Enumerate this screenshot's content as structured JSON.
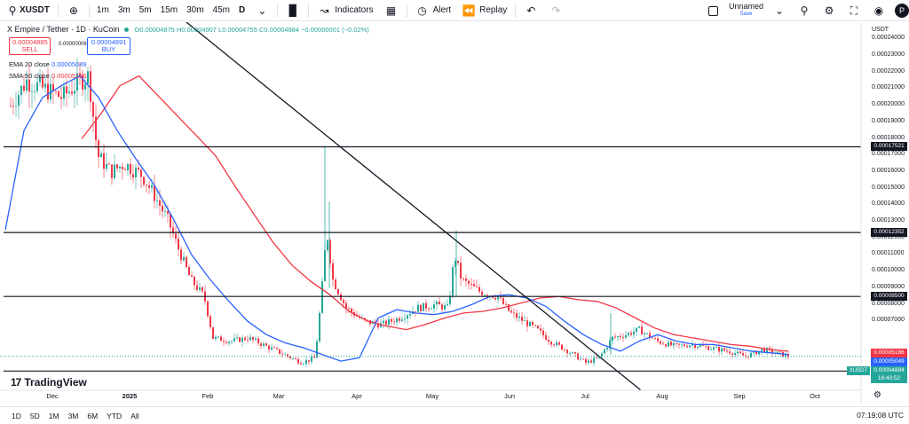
{
  "toolbar": {
    "symbol": "XUSDT",
    "timeframes": [
      "1m",
      "3m",
      "5m",
      "15m",
      "30m",
      "45m",
      "D"
    ],
    "active_timeframe": "D",
    "indicators_label": "Indicators",
    "alert_label": "Alert",
    "replay_label": "Replay",
    "layout_name": "Unnamed",
    "layout_save": "Save",
    "avatar_letter": "P"
  },
  "legend": {
    "title": "X Empire / Tether · 1D · KuCoin",
    "ohlc": "O0.00004875 H0.00004907 L0.00004755 C0.00004884 −0.00000001 (−0.02%)",
    "sell_price": "0.00004885",
    "sell_label": "SELL",
    "spread": "0.00000006",
    "buy_price": "0.00004891",
    "buy_label": "BUY",
    "ema_label": "EMA 20 close",
    "ema_value": "0.00005049",
    "sma_label": "SMA 50 close",
    "sma_value": "0.00005186"
  },
  "price_axis": {
    "currency": "USDT",
    "ticks": [
      "0.00024000",
      "0.00023000",
      "0.00022000",
      "0.00021000",
      "0.00020000",
      "0.00019000",
      "0.00018000",
      "0.00017000",
      "0.00016000",
      "0.00015000",
      "0.00014000",
      "0.00013000",
      "0.00012000",
      "0.00011000",
      "0.00010000",
      "0.00009000",
      "0.00008000",
      "0.00007000"
    ],
    "level_labels": [
      "0.00017521",
      "0.00012352",
      "0.00008500",
      "0.00004000"
    ],
    "sma_tag": "0.00005186",
    "ema_tag": "0.00005049",
    "price_tag": "0.00004884",
    "countdown": "16:40:52",
    "symbol_tag": "XUSDT"
  },
  "time_axis": {
    "labels": [
      "Dec",
      "2025",
      "Feb",
      "Mar",
      "Apr",
      "May",
      "Jun",
      "Jul",
      "Aug",
      "Sep",
      "Oct"
    ]
  },
  "bottom": {
    "ranges": [
      "1D",
      "5D",
      "1M",
      "3M",
      "6M",
      "YTD",
      "All"
    ],
    "clock": "07:19:08 UTC"
  },
  "branding": "TradingView",
  "colors": {
    "up": "#26a69a",
    "down": "#f23645",
    "ema": "#2962ff",
    "sma": "#f23645"
  },
  "chart_data": {
    "type": "candlestick",
    "ylim": [
      3e-05,
      0.000245
    ],
    "horizontal_levels": [
      0.00017521,
      0.00012352,
      8.5e-05,
      4e-05
    ],
    "ema_20": [
      0.000125,
      0.000185,
      0.000205,
      0.000212,
      0.000218,
      0.000205,
      0.000185,
      0.000168,
      0.000152,
      0.000132,
      0.00011,
      9.5e-05,
      8.2e-05,
      7e-05,
      6.2e-05,
      5.7e-05,
      5.4e-05,
      5e-05,
      4.6e-05,
      4.8e-05,
      7.2e-05,
      7.7e-05,
      7.5e-05,
      7.4e-05,
      7.6e-05,
      8e-05,
      8.5e-05,
      8.6e-05,
      8.4e-05,
      7.9e-05,
      7e-05,
      6.2e-05,
      5.6e-05,
      5.2e-05,
      5.8e-05,
      6.2e-05,
      5.8e-05,
      5.6e-05,
      5.6e-05,
      5.4e-05,
      5.2e-05,
      5.1e-05,
      5e-05
    ],
    "sma_50": [
      0.00018,
      0.000195,
      0.000212,
      0.000218,
      0.000206,
      0.000194,
      0.000182,
      0.00017,
      0.000152,
      0.000135,
      0.000118,
      0.000104,
      9.4e-05,
      8.6e-05,
      7.6e-05,
      7e-05,
      6.7e-05,
      6.5e-05,
      6.8e-05,
      7.2e-05,
      7.5e-05,
      7.6e-05,
      7.8e-05,
      8.1e-05,
      8.4e-05,
      8.5e-05,
      8.3e-05,
      8.2e-05,
      7.8e-05,
      7.2e-05,
      6.6e-05,
      6.2e-05,
      6e-05,
      5.8e-05,
      5.6e-05,
      5.5e-05,
      5.3e-05,
      5.2e-05
    ]
  }
}
